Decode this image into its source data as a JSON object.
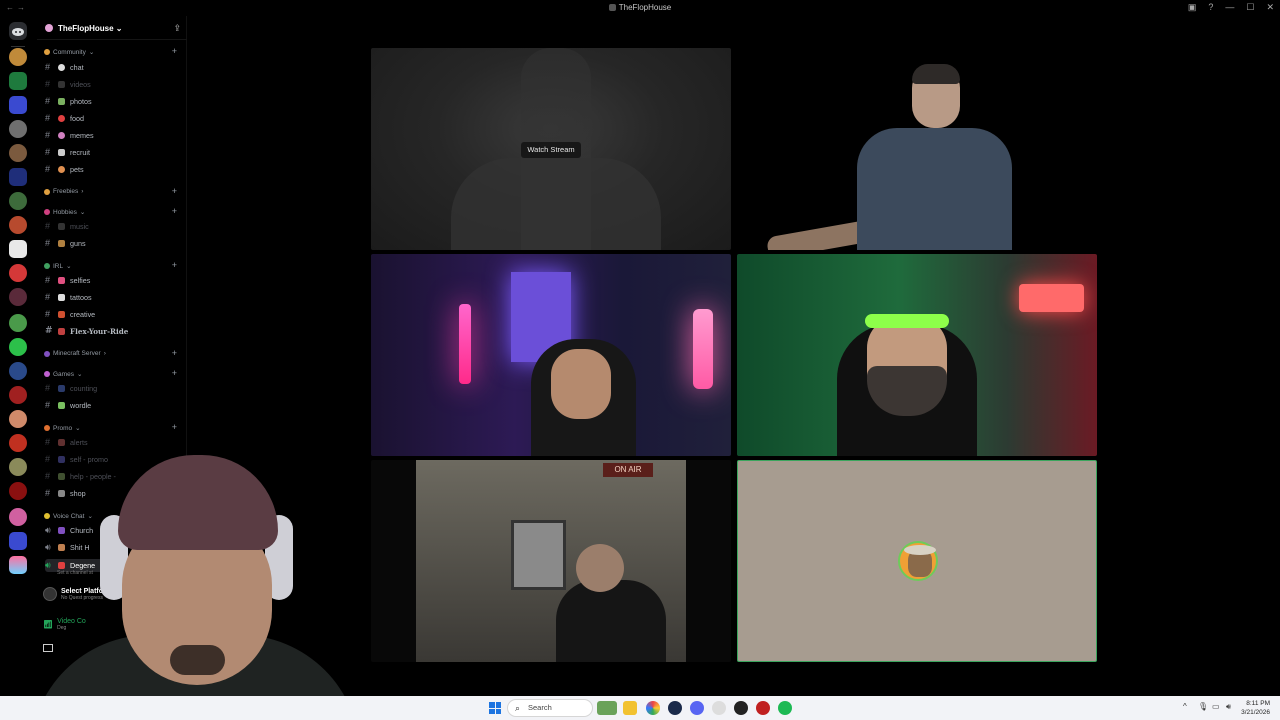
{
  "titlebar": {
    "back": "←",
    "forward": "→",
    "title": "TheFlopHouse"
  },
  "server": {
    "name": "TheFlopHouse"
  },
  "categories": {
    "community": "Community",
    "freebies": "Freebies",
    "hobbies": "Hobbies",
    "irl": "IRL",
    "minecraft": "Minecraft Server",
    "games": "Games",
    "promo": "Promo",
    "voice": "Voice Chat"
  },
  "channels": {
    "chat": "chat",
    "videos": "videos",
    "photos": "photos",
    "food": "food",
    "memes": "memes",
    "recruit": "recruit",
    "pets": "pets",
    "music": "music",
    "guns": "guns",
    "selfies": "selfies",
    "tattoos": "tattoos",
    "creative": "creative",
    "flex": "Flex-Your-Ride",
    "counting": "counting",
    "wordle": "wordle",
    "alerts": "alerts",
    "self_promo": "self - promo",
    "help_people": "help - people -",
    "shop": "shop",
    "church": "Church",
    "shit": "Shit H",
    "degen": "Degene"
  },
  "voice_panel": {
    "set_channel": "Set a channel st",
    "select_platform": "Select Platform",
    "no_quest": "No Quest progress",
    "video_connected": "Video Co",
    "video_sub": "Deg"
  },
  "stage": {
    "watch_stream": "Watch Stream",
    "on_air": "ON AIR"
  },
  "taskbar": {
    "search_placeholder": "Search",
    "time": "8:11 PM",
    "date": "3/21/2026"
  },
  "colors": {
    "accent_green": "#3ba55d",
    "discord_blurple": "#5865f2",
    "taskbar": "#f2f3f7"
  },
  "icons": {
    "discord": "discord-icon",
    "invite": "add-member-icon",
    "search": "search-icon",
    "windows": "windows-start-icon"
  }
}
